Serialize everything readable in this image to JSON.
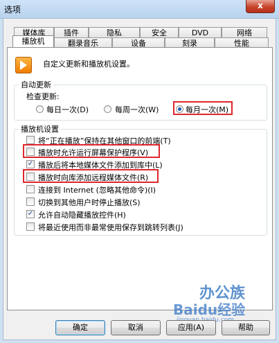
{
  "window": {
    "title": "选项",
    "close_glyph": "x"
  },
  "tabs_row1": [
    "媒体库",
    "插件",
    "隐私",
    "安全",
    "DVD",
    "网络"
  ],
  "tabs_row2": [
    "播放机",
    "翻录音乐",
    "设备",
    "刻录",
    "性能"
  ],
  "active_tab": "播放机",
  "header_text": "自定义更新和播放机设置。",
  "auto_update": {
    "group_label": "自动更新",
    "check_label": "检查更新:",
    "options": [
      {
        "label": "每日一次(D)",
        "selected": false
      },
      {
        "label": "每周一次(W)",
        "selected": false
      },
      {
        "label": "每月一次(M)",
        "selected": true
      }
    ]
  },
  "player_settings": {
    "group_label": "播放机设置",
    "items": [
      {
        "label": "将“正在播放”保持在其他窗口的前端(T)",
        "checked": false
      },
      {
        "label": "播放时允许运行屏幕保护程序(V)",
        "checked": false
      },
      {
        "label": "播放后将本地媒体文件添加到库中(L)",
        "checked": true
      },
      {
        "label": "播放时向库添加远程媒体文件(R)",
        "checked": false
      },
      {
        "label": "连接到 Internet (忽略其他命令)(I)",
        "checked": false
      },
      {
        "label": "切换到其他用户时停止播放(S)",
        "checked": false
      },
      {
        "label": "允许自动隐藏播放控件(H)",
        "checked": true
      },
      {
        "label": "将最近使用而非最常使用保存到跳转列表(J)",
        "checked": false
      }
    ]
  },
  "buttons": {
    "ok": "确定",
    "cancel": "取消",
    "apply": "应用(A)",
    "help": "帮助"
  },
  "watermark": {
    "line1": "办公族",
    "line2": "Baidu经验",
    "line3": "jingyan.baidu.com"
  },
  "accent_colors": {
    "highlight_box": "#e0262d",
    "checkmark": "#1b3f8f"
  }
}
